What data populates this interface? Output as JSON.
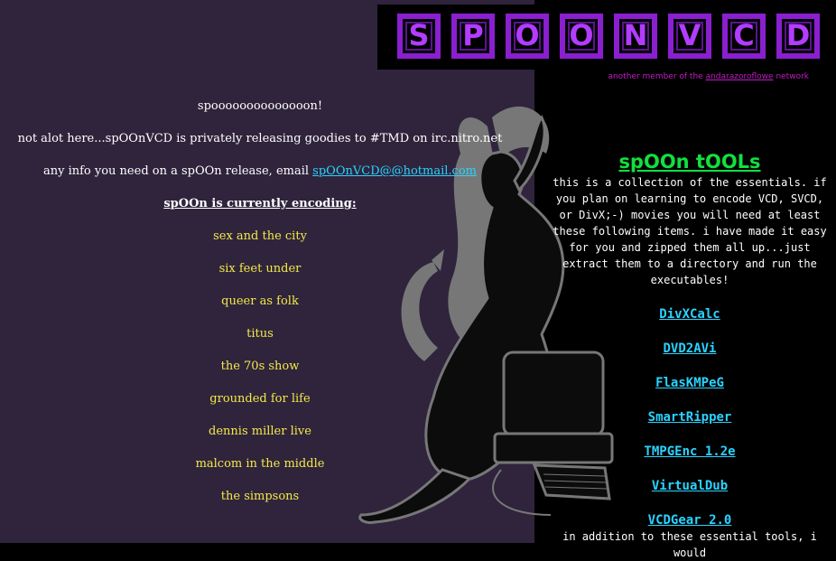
{
  "logo": {
    "letters": [
      "S",
      "P",
      "O",
      "O",
      "N",
      "V",
      "C",
      "D"
    ],
    "accent": "#8a1fd0"
  },
  "network": {
    "prefix": "another member of the",
    "link": "andarazoroflowe",
    "suffix": "network"
  },
  "left": {
    "line1": "spoooooooooooooon!",
    "line2": "not alot here...spOOnVCD is privately releasing goodies to #TMD on irc.nitro.net",
    "line3_prefix": "any info you need on a spOOn release, email",
    "email": "spOOnVCD@@hotmail.com",
    "encoding_title": "spOOn is currently encoding:",
    "shows": [
      "sex and the city",
      "six feet under",
      "queer as folk",
      "titus",
      "the 70s show",
      "grounded for life",
      "dennis miller live",
      "malcom in the middle",
      "the simpsons"
    ]
  },
  "right": {
    "title": "spOOn tOOLs",
    "intro": "this is a collection of the essentials. if you plan on learning to encode VCD, SVCD, or DivX;-) movies you will need at least these following items. i have made it easy for you and zipped them all up...just extract them to a directory and run the executables!",
    "tools": [
      "DivXCalc",
      "DVD2AVi",
      "FlasKMPeG",
      "SmartRipper",
      "TMPGEnc 1.2e",
      "VirtualDub",
      "VCDGear 2.0"
    ],
    "outro": "in addition to these essential tools, i would"
  },
  "colors": {
    "left_bg": "#2f243c",
    "show_text": "#f4e948",
    "link": "#2ad3ff",
    "tools_title": "#11e03f",
    "network_text": "#c21cc6"
  }
}
